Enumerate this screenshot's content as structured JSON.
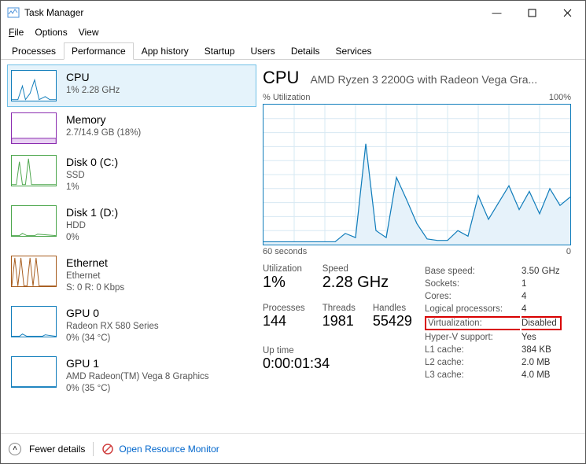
{
  "window": {
    "title": "Task Manager"
  },
  "menus": {
    "file": "File",
    "options": "Options",
    "view": "View"
  },
  "tabs": [
    "Processes",
    "Performance",
    "App history",
    "Startup",
    "Users",
    "Details",
    "Services"
  ],
  "sidebar": [
    {
      "title": "CPU",
      "sub1": "1% 2.28 GHz",
      "sub2": "",
      "color": "#117dbb"
    },
    {
      "title": "Memory",
      "sub1": "2.7/14.9 GB (18%)",
      "sub2": "",
      "color": "#8b2db0"
    },
    {
      "title": "Disk 0 (C:)",
      "sub1": "SSD",
      "sub2": "1%",
      "color": "#4ca64c"
    },
    {
      "title": "Disk 1 (D:)",
      "sub1": "HDD",
      "sub2": "0%",
      "color": "#4ca64c"
    },
    {
      "title": "Ethernet",
      "sub1": "Ethernet",
      "sub2": "S: 0 R: 0 Kbps",
      "color": "#a65b1c"
    },
    {
      "title": "GPU 0",
      "sub1": "Radeon RX 580 Series",
      "sub2": "0% (34 °C)",
      "color": "#117dbb"
    },
    {
      "title": "GPU 1",
      "sub1": "AMD Radeon(TM) Vega 8 Graphics",
      "sub2": "0% (35 °C)",
      "color": "#117dbb"
    }
  ],
  "main": {
    "title": "CPU",
    "subtitle": "AMD Ryzen 3 2200G with Radeon Vega Gra...",
    "graph_top_left": "% Utilization",
    "graph_top_right": "100%",
    "graph_bottom_left": "60 seconds",
    "graph_bottom_right": "0",
    "stats_left": {
      "utilization_label": "Utilization",
      "utilization": "1%",
      "speed_label": "Speed",
      "speed": "2.28 GHz",
      "processes_label": "Processes",
      "processes": "144",
      "threads_label": "Threads",
      "threads": "1981",
      "handles_label": "Handles",
      "handles": "55429",
      "uptime_label": "Up time",
      "uptime": "0:00:01:34"
    },
    "stats_right": [
      [
        "Base speed:",
        "3.50 GHz"
      ],
      [
        "Sockets:",
        "1"
      ],
      [
        "Cores:",
        "4"
      ],
      [
        "Logical processors:",
        "4"
      ],
      [
        "Virtualization:",
        "Disabled"
      ],
      [
        "Hyper-V support:",
        "Yes"
      ],
      [
        "L1 cache:",
        "384 KB"
      ],
      [
        "L2 cache:",
        "2.0 MB"
      ],
      [
        "L3 cache:",
        "4.0 MB"
      ]
    ]
  },
  "footer": {
    "fewer": "Fewer details",
    "monitor": "Open Resource Monitor"
  },
  "chart_data": {
    "type": "line",
    "title": "% Utilization",
    "xlabel": "60 seconds",
    "ylabel": "",
    "ylim": [
      0,
      100
    ],
    "x_seconds_ago": [
      60,
      58,
      56,
      54,
      52,
      50,
      48,
      46,
      44,
      42,
      40,
      38,
      36,
      34,
      32,
      30,
      28,
      26,
      24,
      22,
      20,
      18,
      16,
      14,
      12,
      10,
      8,
      6,
      4,
      2,
      0
    ],
    "values_pct": [
      2,
      2,
      2,
      2,
      2,
      2,
      2,
      2,
      8,
      5,
      72,
      10,
      5,
      48,
      32,
      15,
      4,
      3,
      3,
      10,
      6,
      35,
      18,
      30,
      42,
      25,
      38,
      22,
      40,
      28,
      34
    ]
  }
}
